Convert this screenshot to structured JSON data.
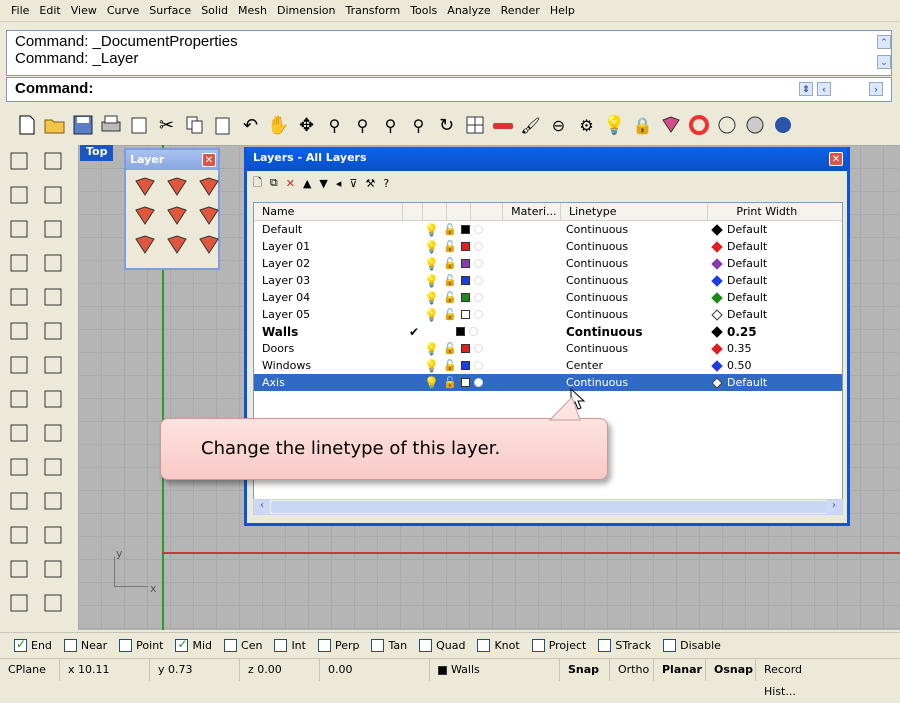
{
  "menu": [
    "File",
    "Edit",
    "View",
    "Curve",
    "Surface",
    "Solid",
    "Mesh",
    "Dimension",
    "Transform",
    "Tools",
    "Analyze",
    "Render",
    "Help"
  ],
  "command_history": [
    "Command: _DocumentProperties",
    "Command: _Layer"
  ],
  "command_prompt": "Command:",
  "viewport": {
    "title": "Top",
    "axis_y": "y",
    "axis_x": "x"
  },
  "layer_palette": {
    "title": "Layer",
    "close": "✕"
  },
  "dialog": {
    "title": "Layers - All Layers",
    "close": "✕",
    "toolbar": [
      "🗋",
      "⧉",
      "✕",
      "▲",
      "▼",
      "◂",
      "⊽",
      "⚒",
      "?"
    ],
    "columns": {
      "name": "Name",
      "material": "Materi...",
      "linetype": "Linetype",
      "print_width": "Print Width"
    },
    "layers": [
      {
        "name": "Default",
        "color": "#000000",
        "linetype": "Continuous",
        "pw_color": "#000000",
        "print_width": "Default"
      },
      {
        "name": "Layer 01",
        "color": "#e02020",
        "linetype": "Continuous",
        "pw_color": "#e02020",
        "print_width": "Default"
      },
      {
        "name": "Layer 02",
        "color": "#8a3ab0",
        "linetype": "Continuous",
        "pw_color": "#8a3ab0",
        "print_width": "Default"
      },
      {
        "name": "Layer 03",
        "color": "#1a3ee0",
        "linetype": "Continuous",
        "pw_color": "#1a3ee0",
        "print_width": "Default"
      },
      {
        "name": "Layer 04",
        "color": "#1a8a1a",
        "linetype": "Continuous",
        "pw_color": "#1a8a1a",
        "print_width": "Default"
      },
      {
        "name": "Layer 05",
        "color": "#ffffff",
        "linetype": "Continuous",
        "pw_color": "#ffffff",
        "print_width": "Default"
      },
      {
        "name": "Walls",
        "color": "#000000",
        "linetype": "Continuous",
        "pw_color": "#000000",
        "print_width": "0.25",
        "current": true
      },
      {
        "name": "Doors",
        "color": "#e02020",
        "linetype": "Continuous",
        "pw_color": "#e02020",
        "print_width": "0.35"
      },
      {
        "name": "Windows",
        "color": "#1a3ee0",
        "linetype": "Center",
        "pw_color": "#1a3ee0",
        "print_width": "0.50"
      },
      {
        "name": "Axis",
        "color": "#ffffff",
        "linetype": "Continuous",
        "pw_color": "#ffffff",
        "print_width": "Default",
        "selected": true
      }
    ]
  },
  "callout": "Change the linetype of this layer.",
  "osnap": [
    {
      "label": "End",
      "checked": true
    },
    {
      "label": "Near",
      "checked": false
    },
    {
      "label": "Point",
      "checked": false
    },
    {
      "label": "Mid",
      "checked": true
    },
    {
      "label": "Cen",
      "checked": false
    },
    {
      "label": "Int",
      "checked": false
    },
    {
      "label": "Perp",
      "checked": false
    },
    {
      "label": "Tan",
      "checked": false
    },
    {
      "label": "Quad",
      "checked": false
    },
    {
      "label": "Knot",
      "checked": false
    },
    {
      "label": "Project",
      "checked": false
    },
    {
      "label": "STrack",
      "checked": false
    },
    {
      "label": "Disable",
      "checked": false
    }
  ],
  "status": {
    "cplane": "CPlane",
    "x": "x 10.11",
    "y": "y 0.73",
    "z": "z 0.00",
    "dist": "0.00",
    "layer": "Walls",
    "snap": "Snap",
    "ortho": "Ortho",
    "planar": "Planar",
    "osnap": "Osnap",
    "record": "Record Hist..."
  }
}
